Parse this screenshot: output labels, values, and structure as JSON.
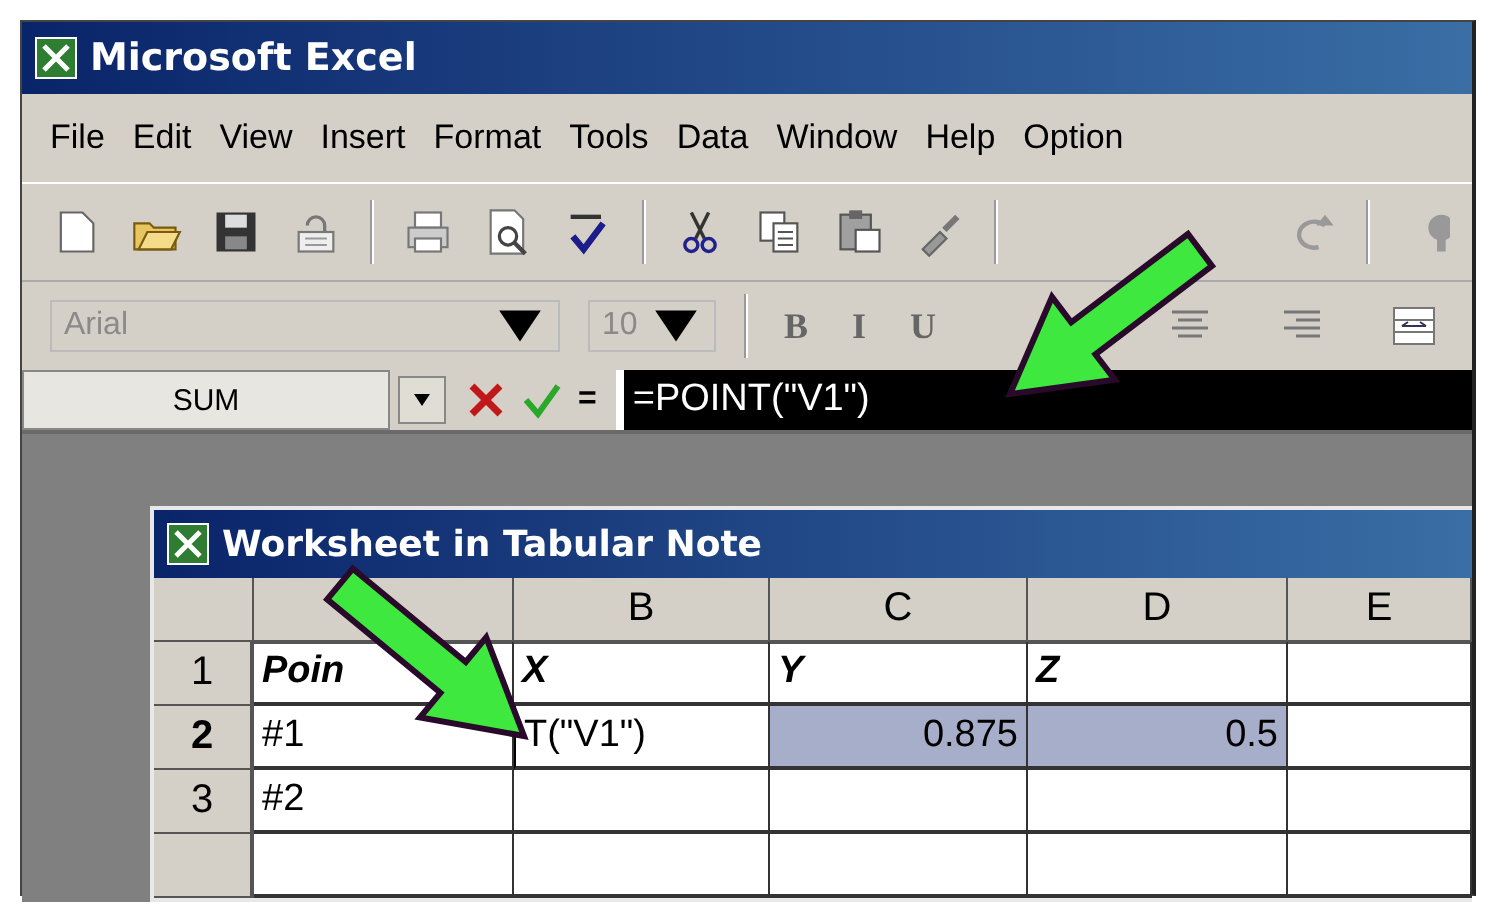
{
  "window": {
    "title": "Microsoft Excel"
  },
  "menu": [
    {
      "label": "File"
    },
    {
      "label": "Edit"
    },
    {
      "label": "View"
    },
    {
      "label": "Insert"
    },
    {
      "label": "Format"
    },
    {
      "label": "Tools"
    },
    {
      "label": "Data"
    },
    {
      "label": "Window"
    },
    {
      "label": "Help"
    },
    {
      "label": "Option"
    }
  ],
  "standard_toolbar": [
    {
      "kind": "new"
    },
    {
      "kind": "open"
    },
    {
      "kind": "save"
    },
    {
      "kind": "permission"
    },
    {
      "kind": "sep"
    },
    {
      "kind": "print"
    },
    {
      "kind": "preview"
    },
    {
      "kind": "spelling"
    },
    {
      "kind": "sep"
    },
    {
      "kind": "cut"
    },
    {
      "kind": "copy"
    },
    {
      "kind": "paste"
    },
    {
      "kind": "painter"
    },
    {
      "kind": "sep"
    },
    {
      "kind": "redo"
    },
    {
      "kind": "sep"
    },
    {
      "kind": "partial"
    }
  ],
  "formatting_toolbar": {
    "font": {
      "value": "Arial",
      "disabled": true
    },
    "size": {
      "value": "10",
      "disabled": true
    },
    "buttons": [
      {
        "kind": "text",
        "label": "B"
      },
      {
        "kind": "text",
        "label": "I"
      },
      {
        "kind": "text",
        "label": "U"
      },
      {
        "kind": "align-center"
      },
      {
        "kind": "align-right"
      },
      {
        "kind": "merge"
      }
    ]
  },
  "formula_bar": {
    "name_box": "SUM",
    "equals": "=",
    "formula": "=POINT(\"V1\")"
  },
  "worksheet": {
    "title": "Worksheet in Tabular Note",
    "columns": [
      {
        "label": "B"
      },
      {
        "label": "C"
      },
      {
        "label": "D"
      },
      {
        "label": "E"
      }
    ],
    "rows": [
      {
        "number": "1",
        "selected": false,
        "emphasis": true,
        "cells": [
          {
            "text": "Poin",
            "selected": false
          },
          {
            "text": "X",
            "selected": false
          },
          {
            "text": "Y",
            "selected": false
          },
          {
            "text": "Z",
            "selected": false
          },
          {
            "selected": false
          }
        ]
      },
      {
        "number": "2",
        "selected": true,
        "emphasis": false,
        "cells": [
          {
            "text": "#1",
            "selected": false
          },
          {
            "text": "T(\"V1\")",
            "selected": false,
            "editing": true
          },
          {
            "text": "0.875",
            "selected": true,
            "numeric": true
          },
          {
            "text": "0.5",
            "selected": true,
            "numeric": true
          },
          {
            "selected": false
          }
        ]
      },
      {
        "number": "3",
        "selected": false,
        "emphasis": false,
        "cells": [
          {
            "text": "#2",
            "selected": false
          },
          {
            "selected": false
          },
          {
            "selected": false
          },
          {
            "selected": false
          },
          {
            "selected": false
          }
        ]
      }
    ]
  }
}
